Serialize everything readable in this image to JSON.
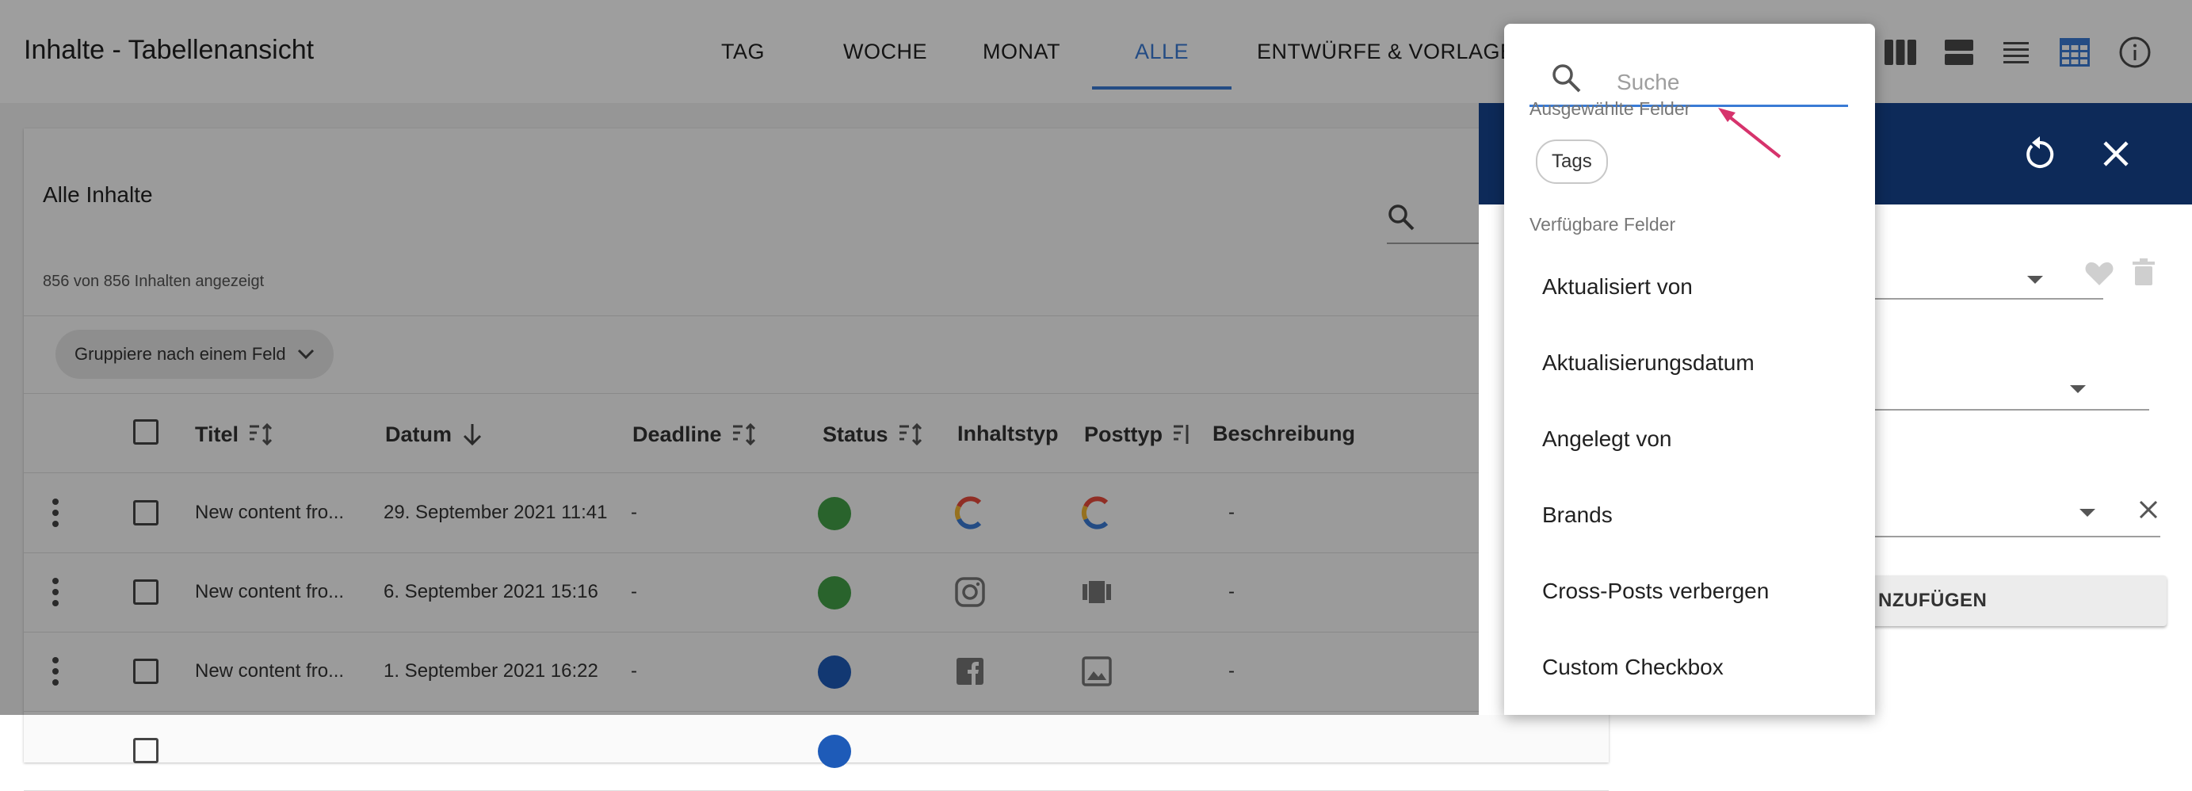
{
  "header": {
    "title": "Inhalte - Tabellenansicht",
    "tabs": [
      {
        "label": "TAG"
      },
      {
        "label": "WOCHE"
      },
      {
        "label": "MONAT"
      },
      {
        "label": "ALLE"
      },
      {
        "label": "ENTWÜRFE & VORLAGEN"
      }
    ],
    "active_tab": "ALLE",
    "view_icons": [
      "columns-view-icon",
      "split-view-icon",
      "list-view-icon",
      "table-view-icon",
      "info-icon"
    ]
  },
  "card": {
    "title": "Alle Inhalte",
    "count_text": "856 von 856 Inhalten angezeigt",
    "group_chip_label": "Gruppiere nach einem Feld"
  },
  "table": {
    "columns": [
      {
        "label": "Titel"
      },
      {
        "label": "Datum"
      },
      {
        "label": "Deadline"
      },
      {
        "label": "Status"
      },
      {
        "label": "Inhaltstyp"
      },
      {
        "label": "Posttyp"
      },
      {
        "label": "Beschreibung"
      }
    ],
    "rows": [
      {
        "title": "New content fro...",
        "date": "29. September 2021 11:41",
        "deadline": "-",
        "status_color": "#43a047",
        "inhaltstyp_icon": "brand-logo-icon",
        "posttyp_icon": "brand-logo-icon",
        "description": "-"
      },
      {
        "title": "New content fro...",
        "date": "6. September 2021 15:16",
        "deadline": "-",
        "status_color": "#43a047",
        "inhaltstyp_icon": "instagram-icon",
        "posttyp_icon": "carousel-icon",
        "description": "-"
      },
      {
        "title": "New content fro...",
        "date": "1. September 2021 16:22",
        "deadline": "-",
        "status_color": "#1e5bb8",
        "inhaltstyp_icon": "facebook-icon",
        "posttyp_icon": "image-icon",
        "description": "-"
      }
    ]
  },
  "panel": {
    "add_button_label": "NZUFÜGEN"
  },
  "dropdown": {
    "search_placeholder": "Suche",
    "selected_label": "Ausgewählte Felder",
    "selected_chips": [
      "Tags"
    ],
    "available_label": "Verfügbare Felder",
    "options": [
      "Aktualisiert von",
      "Aktualisierungsdatum",
      "Angelegt von",
      "Brands",
      "Cross-Posts verbergen",
      "Custom Checkbox"
    ]
  },
  "colors": {
    "accent": "#3a7bd5",
    "panel_header": "#0d2a59",
    "arrow": "#d6336c"
  }
}
